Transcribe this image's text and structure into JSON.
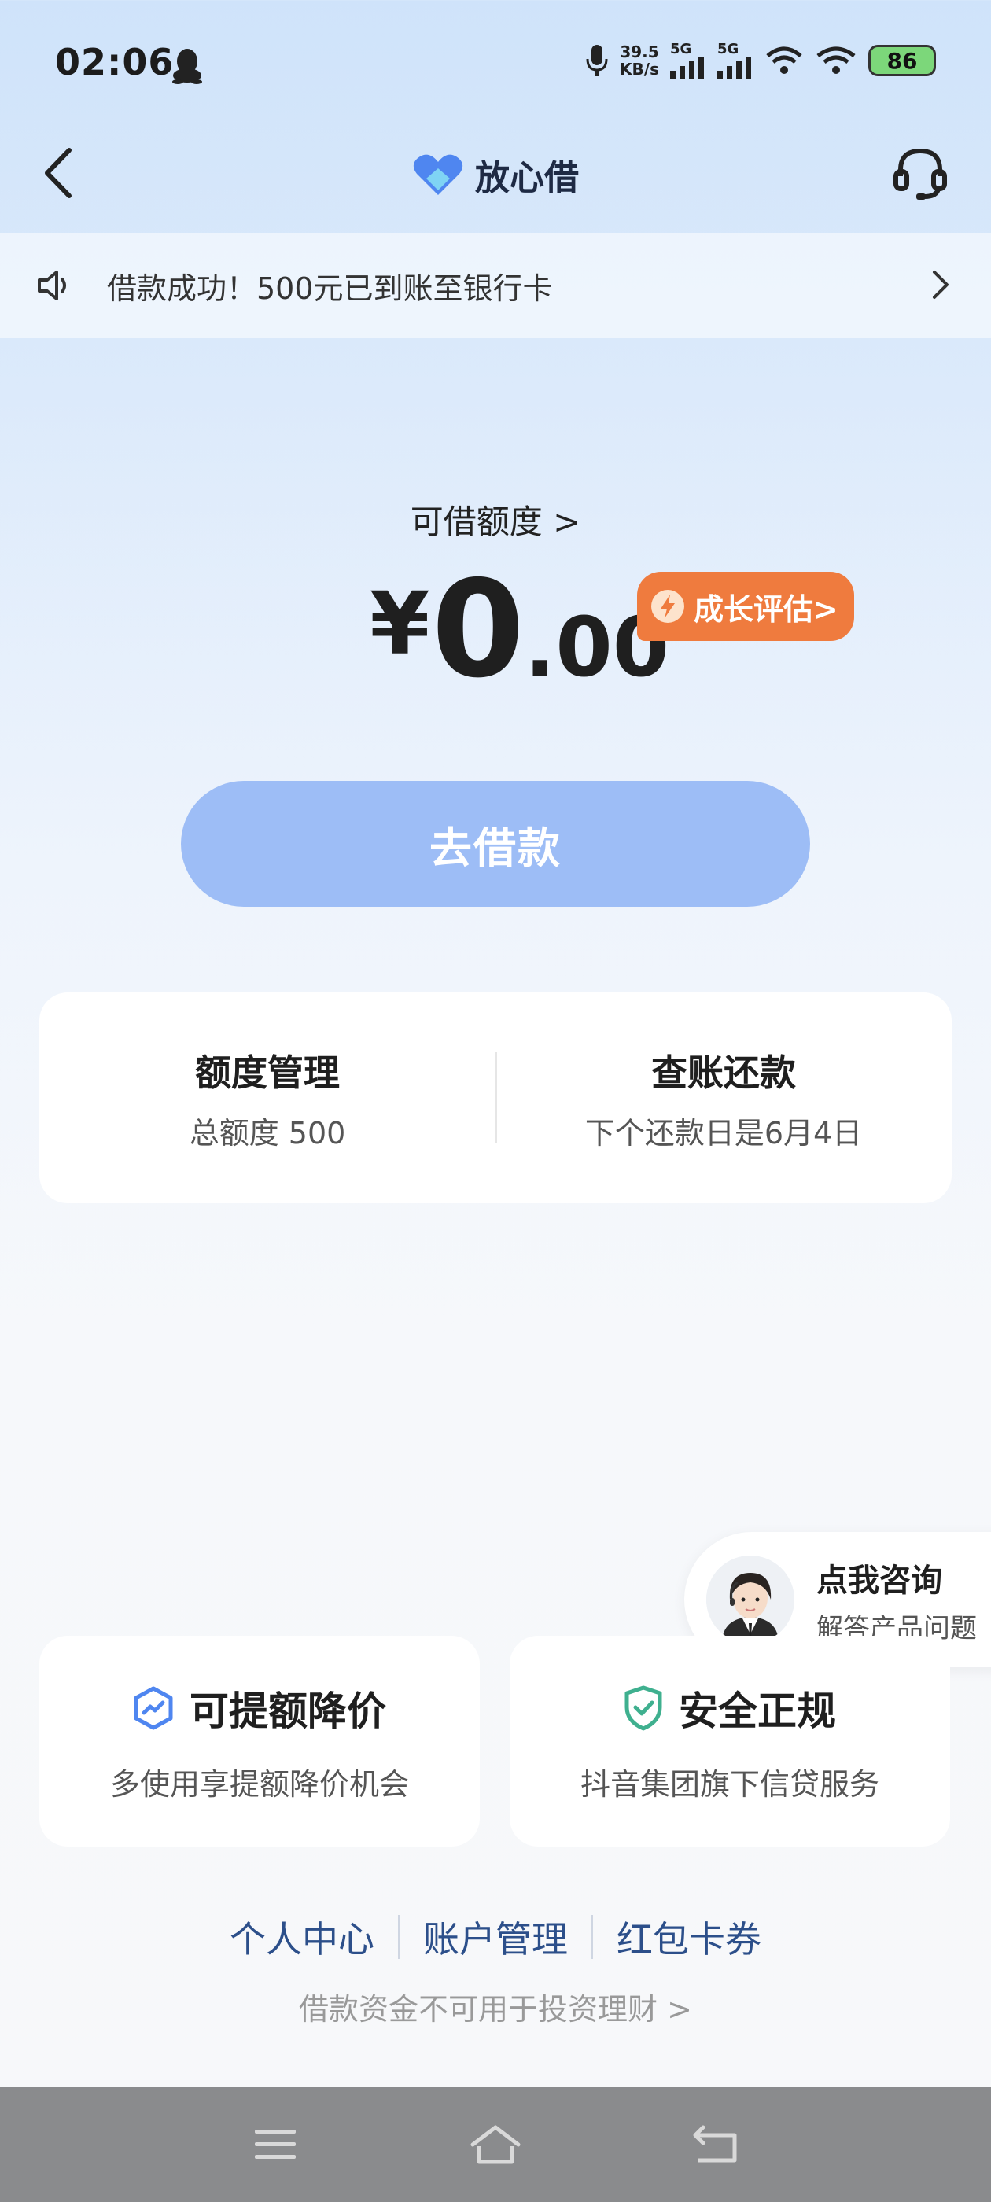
{
  "status_bar": {
    "time": "02:06",
    "net_speed_value": "39.5",
    "net_speed_unit": "KB/s",
    "signal1_label": "5G",
    "signal2_label": "5G",
    "battery": "86"
  },
  "header": {
    "title": "放心借"
  },
  "notice": {
    "text": "借款成功！500元已到账至银行卡"
  },
  "credit": {
    "label": "可借额度 >",
    "currency": "¥",
    "amount_int": "0",
    "amount_dec": ".00",
    "growth_label": "成长评估>"
  },
  "borrow_button": "去借款",
  "management": {
    "limit_title": "额度管理",
    "limit_sub": "总额度 500",
    "repay_title": "查账还款",
    "repay_sub": "下个还款日是6月4日"
  },
  "consult": {
    "title": "点我咨询",
    "subtitle": "解答产品问题"
  },
  "features": [
    {
      "title": "可提额降价",
      "subtitle": "多使用享提额降价机会"
    },
    {
      "title": "安全正规",
      "subtitle": "抖音集团旗下信贷服务"
    }
  ],
  "links": [
    "个人中心",
    "账户管理",
    "红包卡券"
  ],
  "disclaimer": "借款资金不可用于投资理财 >",
  "colors": {
    "accent_orange": "#ef7b3e",
    "button_blue": "#9dbdf6",
    "link_blue": "#2c4f8a"
  }
}
